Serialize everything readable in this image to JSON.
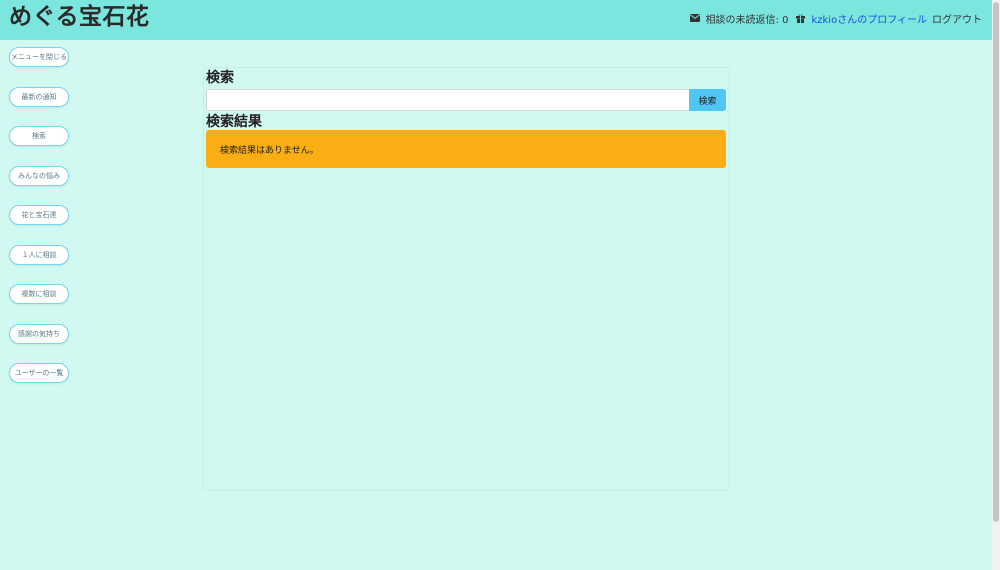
{
  "header": {
    "site_title": "めぐる宝石花",
    "unread_label": "相談の未読返信: 0",
    "profile_link": "kzkioさんのプロフィール",
    "logout_link": "ログアウト",
    "mail_icon": "envelope-icon",
    "gift_icon": "gift-icon"
  },
  "sidebar": {
    "items": [
      {
        "label": "メニューを閉じる"
      },
      {
        "label": "最新の通知"
      },
      {
        "label": "検索"
      },
      {
        "label": "みんなの悩み"
      },
      {
        "label": "花と宝石達"
      },
      {
        "label": "１人に相談"
      },
      {
        "label": "複数に相談"
      },
      {
        "label": "感謝の気持ち"
      },
      {
        "label": "ユーザーの一覧"
      }
    ]
  },
  "search": {
    "heading": "検索",
    "input_value": "",
    "input_placeholder": "",
    "button_label": "検索"
  },
  "results": {
    "heading": "検索結果",
    "empty_message": "検索結果はありません。"
  },
  "colors": {
    "header_bg": "#7ae6dd",
    "page_bg": "#d2f8f2",
    "alert_bg": "#fbae14",
    "button_bg": "#4fc7f6",
    "link": "#1a4de0"
  }
}
